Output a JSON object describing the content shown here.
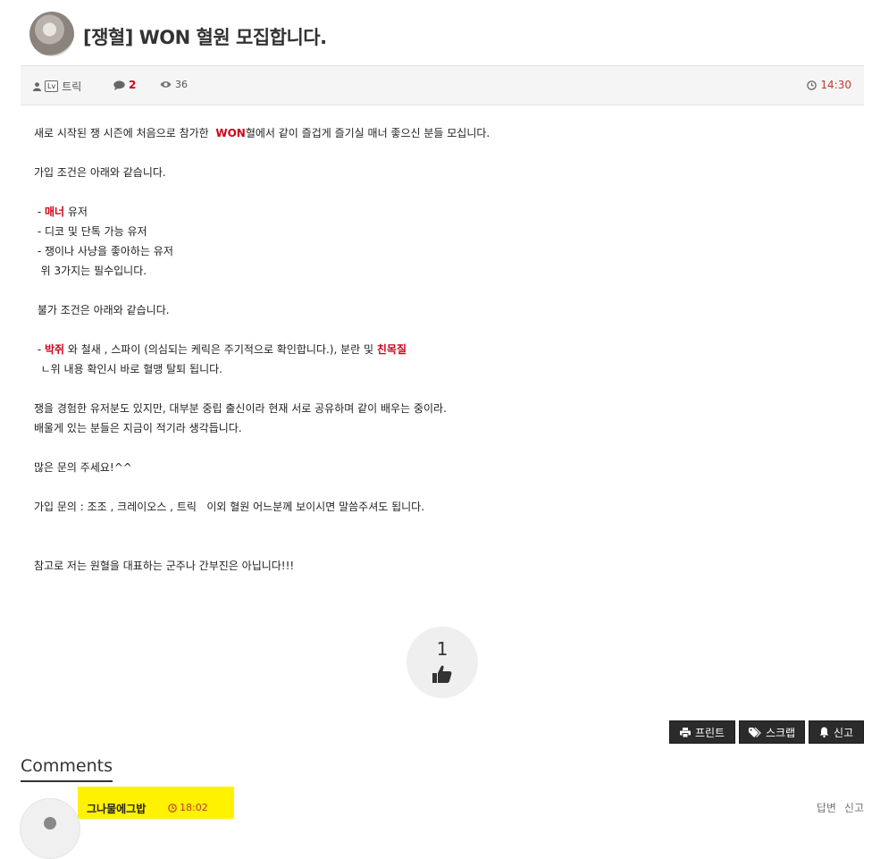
{
  "post": {
    "title": "[쟁혈] WON 혈원 모집합니다.",
    "author": "트릭",
    "author_badge": "Lv",
    "comment_count": "2",
    "view_count": "36",
    "time": "14:30"
  },
  "content": {
    "l1_pre": "새로 시작된 쟁 시즌에 처음으로 참가한  ",
    "l1_red": "WON",
    "l1_post": "혈에서 같이 즐겁게 즐기실 매너 좋으신 분들 모십니다.",
    "l2": "가입 조건은 아래와 같습니다.",
    "l3_pre": " - ",
    "l3_red": "매너",
    "l3_post": " 유저",
    "l4": " - 디코 및 단톡 가능 유저",
    "l5": " - 쟁이나 사냥을 좋아하는 유저",
    "l6": "  위 3가지는 필수입니다.",
    "l7": " 불가 조건은 아래와 같습니다.",
    "l8_pre": " - ",
    "l8_red1": "박쥐",
    "l8_mid": " 와 철새 , 스파이 (의심되는 케릭은 주기적으로 확인합니다.), 분란 및 ",
    "l8_red2": "친목질",
    "l9": "  ㄴ위 내용 확인시 바로 혈맹 탈퇴 됩니다.",
    "l10": "쟁을 경험한 유저분도 있지만, 대부분 중립 출신이라 현재 서로 공유하며 같이 배우는 중이라.",
    "l11": "배울게 있는 분들은 지금이 적기라 생각듭니다.",
    "l12": "많은 문의 주세요!^^",
    "l13": "가입 문의 : 조조 , 크레이오스 , 트릭   이외 혈원 어느분께 보이시면 말씀주셔도 됩니다.",
    "l14": "참고로 저는 원혈을 대표하는 군주나 간부진은 아닙니다!!!"
  },
  "like": {
    "count": "1"
  },
  "buttons": {
    "print": "프린트",
    "scrap": "스크랩",
    "report": "신고"
  },
  "comments": {
    "title": "Comments",
    "items": [
      {
        "author": "그나물에그밥",
        "time": "18:02",
        "reply": "답변",
        "report": "신고"
      }
    ]
  },
  "colors": {
    "accent_red": "#d0021b",
    "time_red": "#c0392b",
    "highlight": "#fff200"
  }
}
